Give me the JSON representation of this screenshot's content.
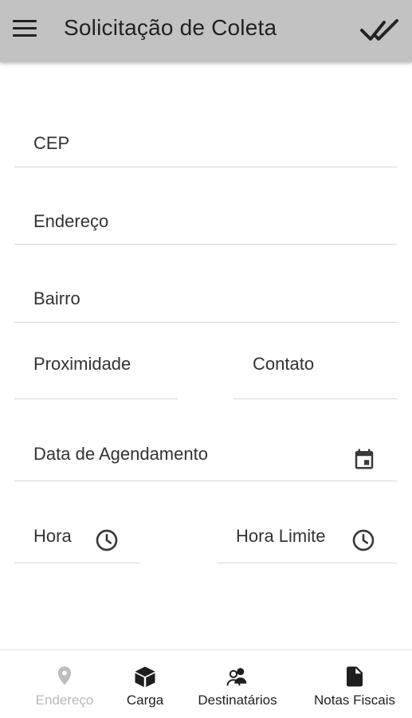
{
  "appbar": {
    "title": "Solicitação de Coleta",
    "menu_icon": "menu-icon",
    "action_icon": "done-all-icon"
  },
  "form": {
    "cep_label": "CEP",
    "endereco_label": "Endereço",
    "bairro_label": "Bairro",
    "proximidade_label": "Proximidade",
    "contato_label": "Contato",
    "data_agendamento_label": "Data de Agendamento",
    "data_icon": "calendar-icon",
    "hora_label": "Hora",
    "hora_limite_label": "Hora Limite",
    "time_icon": "clock-icon"
  },
  "bottom_nav": {
    "items": [
      {
        "label": "Endereço",
        "icon": "location-pin-icon",
        "active": true
      },
      {
        "label": "Carga",
        "icon": "box-icon",
        "active": false
      },
      {
        "label": "Destinatários",
        "icon": "people-icon",
        "active": false
      },
      {
        "label": "Notas Fiscais",
        "icon": "document-icon",
        "active": false
      }
    ]
  },
  "colors": {
    "appbar_bg": "#c2c2c2",
    "divider": "#d6d6d6",
    "active_nav": "#b9b9b9",
    "text": "#222222"
  }
}
